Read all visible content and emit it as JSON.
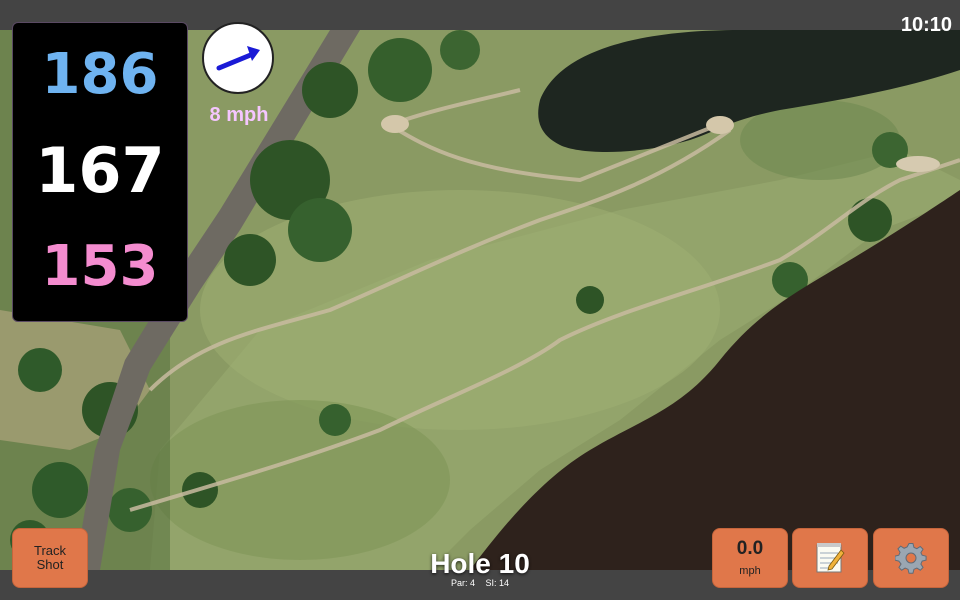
{
  "status_bar": {
    "clock": "10:10"
  },
  "yardage": {
    "back": "186",
    "center": "167",
    "front": "153",
    "colors": {
      "back": "#6fb3f0",
      "center": "#ffffff",
      "front": "#f48ccf"
    }
  },
  "wind": {
    "speed": "8 mph",
    "icon": "wind-direction-arrow-icon",
    "arrow_color": "#1a1ad6"
  },
  "track_shot": {
    "label_line1": "Track",
    "label_line2": "Shot"
  },
  "speed_display": {
    "value": "0.0",
    "unit": "mph"
  },
  "notes": {
    "icon": "notepad-icon"
  },
  "settings": {
    "icon": "gear-icon"
  },
  "hole": {
    "title": "Hole 10",
    "par": "Par: 4",
    "si": "SI: 14"
  },
  "colors": {
    "button": "#e0774a",
    "bar": "#444444",
    "water": "#2e221c"
  }
}
